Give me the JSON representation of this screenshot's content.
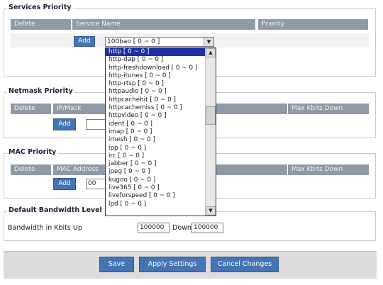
{
  "services": {
    "legend": "Services Priority",
    "columns": [
      "Delete",
      "Service Name",
      "Priority"
    ],
    "add_label": "Add",
    "select_value": "100bao [ 0 ~ 0 ]"
  },
  "dropdown": {
    "selected_index": 0,
    "options": [
      "http [ 0 ~ 0 ]",
      "http-dap [ 0 ~ 0 ]",
      "http-freshdownload [ 0 ~ 0 ]",
      "http-itunes [ 0 ~ 0 ]",
      "http-rtsp [ 0 ~ 0 ]",
      "httpaudio [ 0 ~ 0 ]",
      "httpcachehit [ 0 ~ 0 ]",
      "httpcachemiss [ 0 ~ 0 ]",
      "httpvideo [ 0 ~ 0 ]",
      "ident [ 0 ~ 0 ]",
      "imap [ 0 ~ 0 ]",
      "imesh [ 0 ~ 0 ]",
      "ipp [ 0 ~ 0 ]",
      "irc [ 0 ~ 0 ]",
      "jabber [ 0 ~ 0 ]",
      "jpeg [ 0 ~ 0 ]",
      "kugoo [ 0 ~ 0 ]",
      "live365 [ 0 ~ 0 ]",
      "liveforspeed [ 0 ~ 0 ]",
      "lpd [ 0 ~ 0 ]"
    ],
    "scroll_up_icon": "triangle-up",
    "scroll_down_icon": "triangle-down"
  },
  "netmask": {
    "legend": "Netmask Priority",
    "columns": [
      "Delete",
      "IP/Mask",
      "Max Kbits Down"
    ],
    "add_label": "Add"
  },
  "mac": {
    "legend": "MAC Priority",
    "columns": [
      "Delete",
      "MAC Address",
      "Max Kbits Down"
    ],
    "add_label": "Add",
    "input_partial": "00"
  },
  "bandwidth": {
    "legend": "Default Bandwidth Level",
    "label": "Bandwidth in Kbits Up",
    "up_value": "100000",
    "down_label": "Down",
    "down_value": "100000"
  },
  "actions": {
    "save_label": "Save",
    "apply_label": "Apply Settings",
    "cancel_label": "Cancel Changes"
  }
}
